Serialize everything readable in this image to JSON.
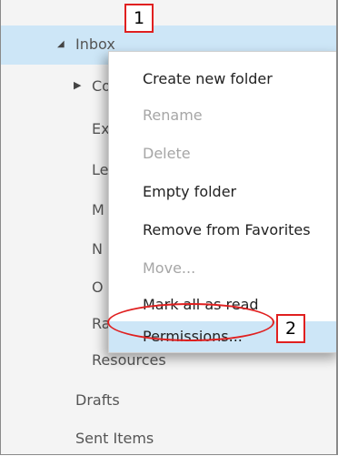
{
  "folder_pane": {
    "inbox_label": "Inbox",
    "children": [
      {
        "label": "Co",
        "expandable": true
      },
      {
        "label": "Ex"
      },
      {
        "label": "Le"
      },
      {
        "label": "M"
      },
      {
        "label": "N"
      },
      {
        "label": "O"
      },
      {
        "label": "Ra"
      },
      {
        "label": "Resources"
      }
    ],
    "drafts_label": "Drafts",
    "sent_label": "Sent Items"
  },
  "context_menu": {
    "items": [
      {
        "label": "Create new folder",
        "enabled": true
      },
      {
        "label": "Rename",
        "enabled": false
      },
      {
        "label": "Delete",
        "enabled": false
      },
      {
        "label": "Empty folder",
        "enabled": true
      },
      {
        "label": "Remove from Favorites",
        "enabled": true
      },
      {
        "label": "Move...",
        "enabled": false
      },
      {
        "label": "Mark all as read",
        "enabled": true
      },
      {
        "label": "Permissions...",
        "enabled": true,
        "highlighted": true
      }
    ]
  },
  "callouts": {
    "one": "1",
    "two": "2"
  },
  "colors": {
    "selection": "#cde6f7",
    "callout_red": "#e02020",
    "pane_bg": "#f4f4f4"
  }
}
